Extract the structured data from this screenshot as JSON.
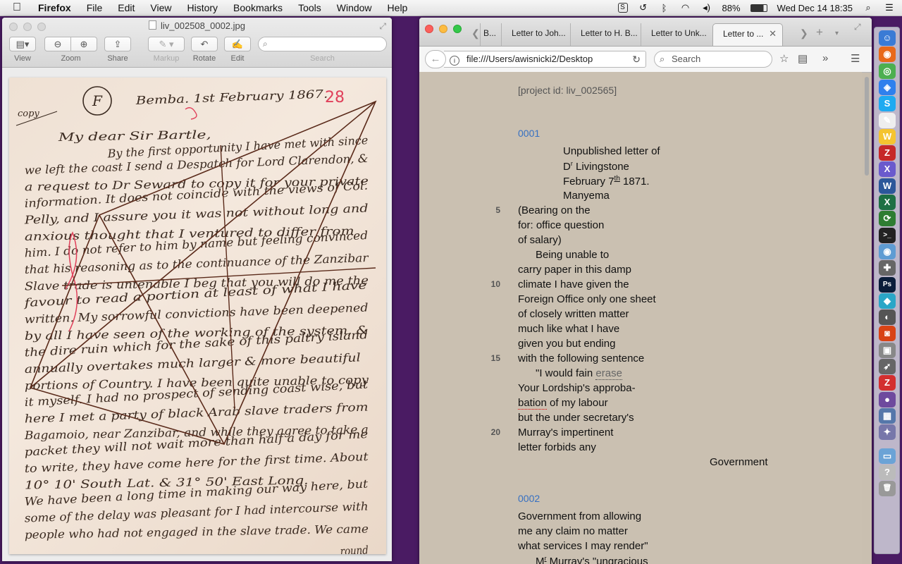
{
  "menubar": {
    "app": "Firefox",
    "items": [
      "File",
      "Edit",
      "View",
      "History",
      "Bookmarks",
      "Tools",
      "Window",
      "Help"
    ],
    "battery": "88%",
    "clock": "Wed Dec 14  18:35"
  },
  "preview": {
    "title": "liv_002508_0002.jpg",
    "toolbar": {
      "view": "View",
      "zoom": "Zoom",
      "share": "Share",
      "markup": "Markup",
      "rotate": "Rotate",
      "edit": "Edit",
      "search_label": "Search"
    },
    "letter_lines": [
      "Bemba. 1st February 1867.",
      "My dear Sir Bartle,",
      "By the first opportunity I have met with since",
      "we left the coast I send a Despatch for Lord Clarendon, &",
      "a request to Dr Seward to copy it for your private",
      "information. It does not coincide with the views of Col.",
      "Pelly, and I assure you it was not without long and",
      "anxious thought that I ventured to differ from",
      "him. I do not refer to him by name but feeling convinced",
      "that his reasoning as to the continuance of the Zanzibar",
      "Slave trade is untenable I beg that you will do me the",
      "favour to read a portion at least of what I have",
      "written. My sorrowful convictions have been deepened",
      "by all I have seen of the working of the system, &",
      "the dire ruin which for the sake of this paltry island",
      "annually overtakes much larger & more beautiful",
      "portions of Country. I have been quite unable to copy",
      "it myself. I had no prospect of sending coast wise, but",
      "here I met a party of black Arab slave traders from",
      "Bagamoio, near Zanzibar, and while they agree to take a",
      "packet they will not wait more than half a day for me",
      "to write, they have come here for the first time. About",
      "10° 10' South Lat. & 31° 50' East Long.",
      "We have been a long time in making our way here, but",
      "some of the delay was pleasant for I had intercourse with",
      "people who had not engaged in the slave trade. We came",
      "round"
    ],
    "annotations": {
      "copy": "copy",
      "circled": "F",
      "page_number": "28"
    }
  },
  "firefox": {
    "tabs": [
      "B...",
      "Letter to Joh...",
      "Letter to H. B...",
      "Letter to Unk...",
      "Letter to ..."
    ],
    "active_tab": 4,
    "url": "file:///Users/awisnicki2/Desktop",
    "search_placeholder": "Search",
    "page": {
      "project_id": "[project id: liv_002565]",
      "section1": "0001",
      "lines1": [
        "Unpublished letter of",
        "Dr Livingstone",
        "February 7th 1871.",
        "Manyema",
        "(Bearing on the",
        "for: office question",
        "of salary)",
        "Being unable to",
        "carry paper in this damp",
        "climate I have given the",
        "Foreign Office only one sheet",
        "of closely written matter",
        "much like what I have",
        "given you but ending",
        "with the following sentence",
        "\"I would fain",
        "erase",
        "Your Lordship's approba-",
        "bation",
        "of my labour",
        "but the under secretary's",
        "Murray's impertinent",
        "letter forbids any",
        "Government"
      ],
      "line_numbers": [
        "5",
        "10",
        "15",
        "20"
      ],
      "section2": "0002",
      "lines2": [
        "Government from allowing",
        "me any claim no matter",
        "what services I may render\"",
        "Mr Murray's \"ungracious"
      ]
    }
  },
  "dock_icons": [
    "finder-icon",
    "firefox-icon",
    "chrome-icon",
    "safari-icon",
    "skype-icon",
    "textedit-icon",
    "stuffit-icon",
    "filezilla-icon",
    "x11-icon",
    "word-icon",
    "excel-icon",
    "sync-icon",
    "terminal-icon",
    "network-icon",
    "utilities-icon",
    "photoshop-icon",
    "sourcetree-icon",
    "gimp-icon",
    "photobooth-icon",
    "screenshot-icon",
    "rocket-icon",
    "zotero-icon",
    "github-icon",
    "preview-icon",
    "app-icon",
    "folder-icon",
    "help-icon",
    "trash-icon"
  ]
}
